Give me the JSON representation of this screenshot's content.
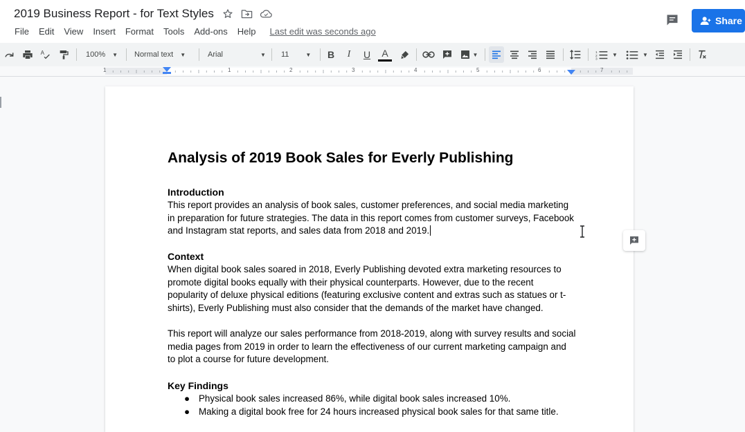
{
  "header": {
    "doc_title": "2019 Business Report - for Text Styles",
    "menu": [
      "File",
      "Edit",
      "View",
      "Insert",
      "Format",
      "Tools",
      "Add-ons",
      "Help"
    ],
    "last_edit": "Last edit was seconds ago",
    "share_label": "Share",
    "icons": [
      "star-icon",
      "move-folder-icon",
      "cloud-status-icon",
      "comment-history-icon",
      "person-add-icon"
    ]
  },
  "toolbar": {
    "zoom": "100%",
    "style": "Normal text",
    "font": "Arial",
    "font_size": "11",
    "bold": "B",
    "italic": "I",
    "underline": "U",
    "text_color": "A",
    "text_color_value": "#000000"
  },
  "ruler": {
    "numbers": [
      "1",
      "1",
      "2",
      "3",
      "4",
      "5",
      "6",
      "7"
    ]
  },
  "document": {
    "title": "Analysis of 2019 Book Sales for Everly Publishing",
    "sections": [
      {
        "heading": "Introduction",
        "paragraphs": [
          "This report provides an analysis of book sales, customer preferences, and social media marketing in preparation for future strategies. The data in this report comes from customer surveys, Facebook and Instagram stat reports, and sales data from 2018 and 2019."
        ]
      },
      {
        "heading": "Context",
        "paragraphs": [
          "When digital book sales soared in 2018, Everly Publishing devoted extra marketing resources to promote digital books equally with their physical counterparts. However, due to the recent popularity of deluxe physical editions (featuring exclusive content and extras such as statues or t-shirts), Everly Publishing must also consider that the demands of the market have changed.",
          "This report will analyze our sales performance from 2018-2019, along with survey results and social media pages from 2019 in order to learn the effectiveness of our current marketing campaign and to plot a course for future development."
        ]
      },
      {
        "heading": "Key Findings",
        "bullets": [
          "Physical book sales increased 86%, while digital book sales increased 10%.",
          "Making a digital book free for 24 hours increased physical book sales for that same title."
        ]
      }
    ],
    "bullet_char": "●"
  },
  "colors": {
    "accent": "#1a73e8",
    "toolbar_bg": "#f1f3f4",
    "canvas_bg": "#f8f9fa"
  }
}
